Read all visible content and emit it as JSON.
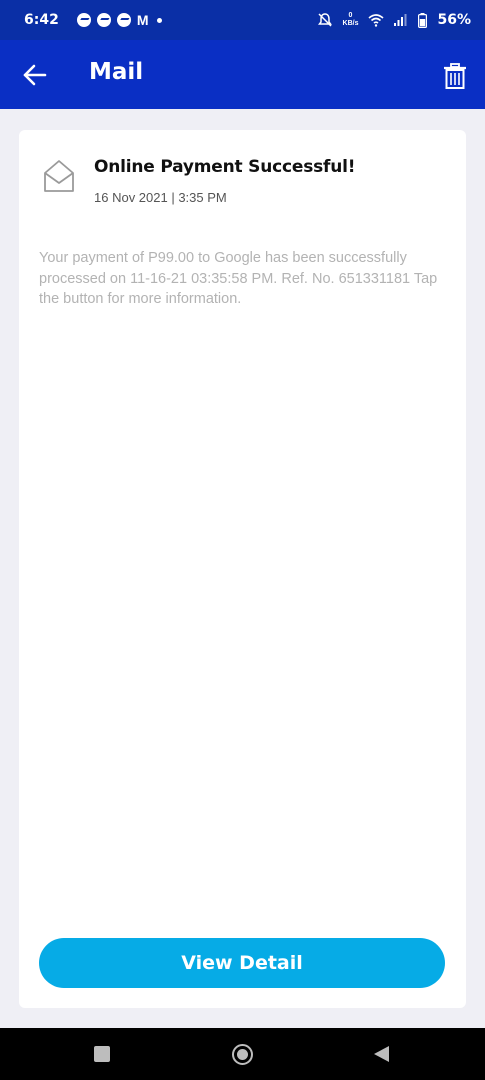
{
  "status_bar": {
    "time": "6:42",
    "gmail_letter": "M",
    "net_speed_value": "0",
    "net_speed_unit": "KB/s",
    "battery_percent": "56%"
  },
  "app_bar": {
    "title": "Mail"
  },
  "mail": {
    "subject": "Online Payment Successful!",
    "date": "16 Nov 2021 | 3:35 PM",
    "body": "Your payment of P99.00 to Google has been successfully processed on 11-16-21 03:35:58 PM. Ref. No. 651331181 Tap the button for more information.",
    "button_label": "View Detail"
  },
  "colors": {
    "status_bar": "#0a2fa6",
    "app_bar": "#0a2fc4",
    "button": "#06abe6",
    "background": "#efeff5"
  },
  "icons": {
    "back": "arrow-left-icon",
    "delete": "trash-icon",
    "mail": "envelope-open-icon"
  }
}
